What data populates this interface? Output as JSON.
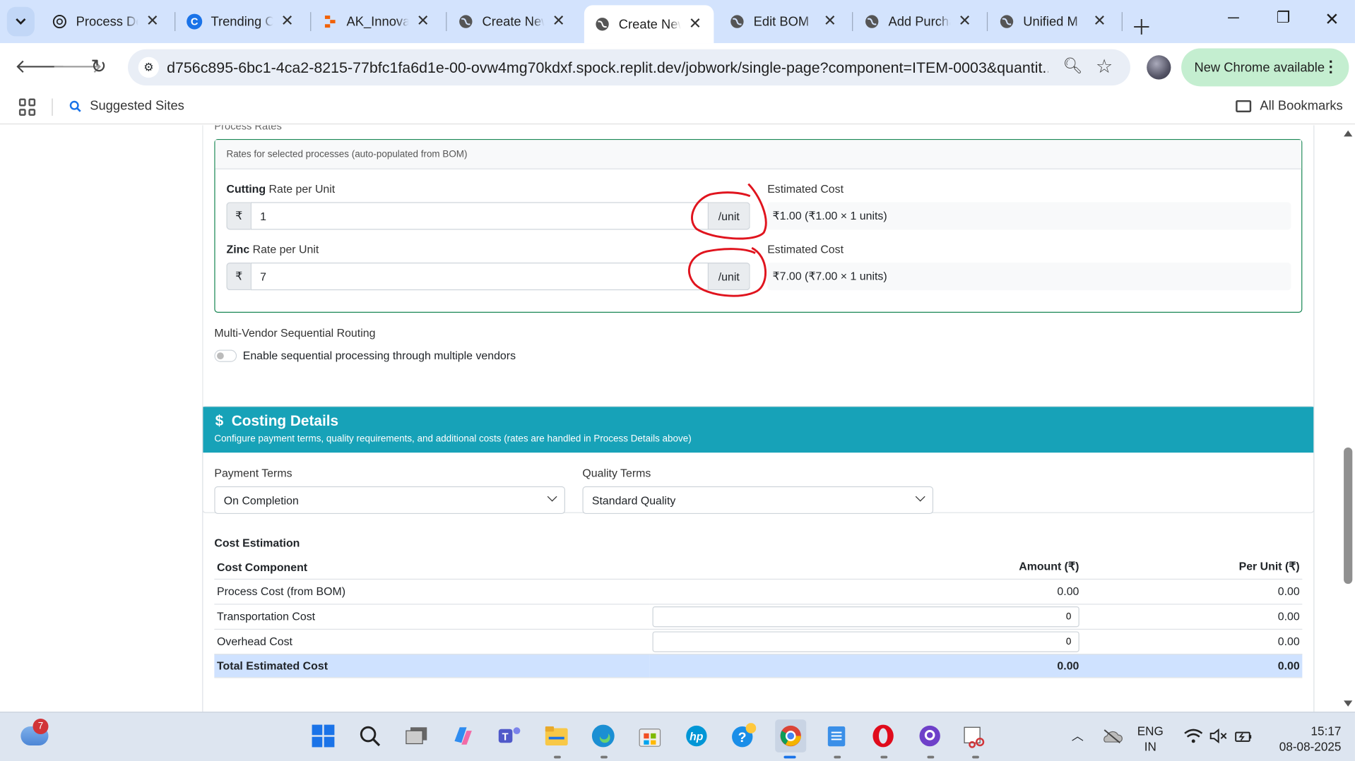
{
  "browser": {
    "tabs": [
      {
        "title": "Process Details"
      },
      {
        "title": "Trending C"
      },
      {
        "title": "AK_Innovations"
      },
      {
        "title": "Create New"
      },
      {
        "title": "Create New",
        "active": true
      },
      {
        "title": "Edit BOM"
      },
      {
        "title": "Add Purchase"
      },
      {
        "title": "Unified M"
      }
    ],
    "url": "d756c895-6bc1-4ca2-8215-77bfc1fa6d1e-00-ovw4mg70kdxf.spock.replit.dev/jobwork/single-page?component=ITEM-0003&quantit...",
    "update_button": "New Chrome available",
    "bookmarks": {
      "suggested": "Suggested Sites",
      "all": "All Bookmarks"
    }
  },
  "page": {
    "process_rates": {
      "clipped_title": "Process Rates",
      "header": "Rates for selected processes (auto-populated from BOM)",
      "rows": [
        {
          "process": "Cutting",
          "rate_label": " Rate per Unit",
          "currency": "₹",
          "value": "1",
          "suffix": "/unit",
          "est_label": "Estimated Cost",
          "est_value": "₹1.00 (₹1.00 × 1 units)"
        },
        {
          "process": "Zinc",
          "rate_label": " Rate per Unit",
          "currency": "₹",
          "value": "7",
          "suffix": "/unit",
          "est_label": "Estimated Cost",
          "est_value": "₹7.00 (₹7.00 × 1 units)"
        }
      ]
    },
    "routing": {
      "title": "Multi-Vendor Sequential Routing",
      "toggle_label": "Enable sequential processing through multiple vendors",
      "enabled": false
    },
    "costing": {
      "icon": "$",
      "title": "Costing Details",
      "subtitle": "Configure payment terms, quality requirements, and additional costs (rates are handled in Process Details above)",
      "payment_label": "Payment Terms",
      "payment_value": "On Completion",
      "quality_label": "Quality Terms",
      "quality_value": "Standard Quality",
      "estimation_title": "Cost Estimation",
      "table": {
        "headers": [
          "Cost Component",
          "Amount (₹)",
          "Per Unit (₹)"
        ],
        "rows": [
          {
            "component": "Process Cost (from BOM)",
            "amount": "0.00",
            "per_unit": "0.00"
          },
          {
            "component": "Transportation Cost",
            "amount": "0",
            "per_unit": "0.00"
          },
          {
            "component": "Overhead Cost",
            "amount": "0",
            "per_unit": "0.00"
          }
        ],
        "total": {
          "component": "Total Estimated Cost",
          "amount": "0.00",
          "per_unit": "0.00"
        }
      }
    }
  },
  "taskbar": {
    "weather_badge": "7",
    "language": "ENG",
    "region": "IN",
    "time": "15:17",
    "date": "08-08-2025"
  },
  "colors": {
    "tab_strip": "#d3e3fd",
    "costing_header": "#17a2b8",
    "rates_border": "#198754",
    "total_row": "#cfe2ff",
    "annotation_red": "#e0141e"
  }
}
